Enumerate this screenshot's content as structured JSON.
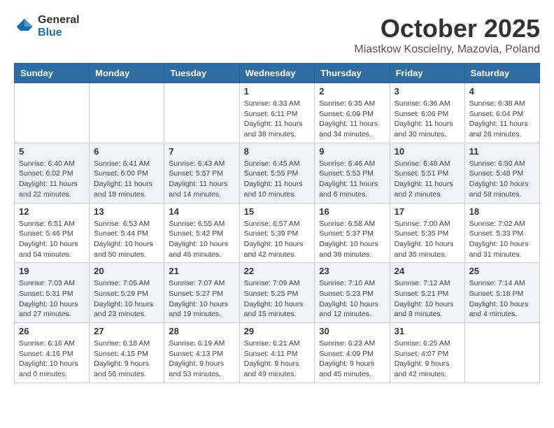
{
  "logo": {
    "general": "General",
    "blue": "Blue"
  },
  "title": "October 2025",
  "location": "Miastkow Koscielny, Mazovia, Poland",
  "days_of_week": [
    "Sunday",
    "Monday",
    "Tuesday",
    "Wednesday",
    "Thursday",
    "Friday",
    "Saturday"
  ],
  "weeks": [
    [
      {
        "day": "",
        "info": ""
      },
      {
        "day": "",
        "info": ""
      },
      {
        "day": "",
        "info": ""
      },
      {
        "day": "1",
        "info": "Sunrise: 6:33 AM\nSunset: 6:11 PM\nDaylight: 11 hours\nand 38 minutes."
      },
      {
        "day": "2",
        "info": "Sunrise: 6:35 AM\nSunset: 6:09 PM\nDaylight: 11 hours\nand 34 minutes."
      },
      {
        "day": "3",
        "info": "Sunrise: 6:36 AM\nSunset: 6:06 PM\nDaylight: 11 hours\nand 30 minutes."
      },
      {
        "day": "4",
        "info": "Sunrise: 6:38 AM\nSunset: 6:04 PM\nDaylight: 11 hours\nand 26 minutes."
      }
    ],
    [
      {
        "day": "5",
        "info": "Sunrise: 6:40 AM\nSunset: 6:02 PM\nDaylight: 11 hours\nand 22 minutes."
      },
      {
        "day": "6",
        "info": "Sunrise: 6:41 AM\nSunset: 6:00 PM\nDaylight: 11 hours\nand 18 minutes."
      },
      {
        "day": "7",
        "info": "Sunrise: 6:43 AM\nSunset: 5:57 PM\nDaylight: 11 hours\nand 14 minutes."
      },
      {
        "day": "8",
        "info": "Sunrise: 6:45 AM\nSunset: 5:55 PM\nDaylight: 11 hours\nand 10 minutes."
      },
      {
        "day": "9",
        "info": "Sunrise: 6:46 AM\nSunset: 5:53 PM\nDaylight: 11 hours\nand 6 minutes."
      },
      {
        "day": "10",
        "info": "Sunrise: 6:48 AM\nSunset: 5:51 PM\nDaylight: 11 hours\nand 2 minutes."
      },
      {
        "day": "11",
        "info": "Sunrise: 6:50 AM\nSunset: 5:48 PM\nDaylight: 10 hours\nand 58 minutes."
      }
    ],
    [
      {
        "day": "12",
        "info": "Sunrise: 6:51 AM\nSunset: 5:46 PM\nDaylight: 10 hours\nand 54 minutes."
      },
      {
        "day": "13",
        "info": "Sunrise: 6:53 AM\nSunset: 5:44 PM\nDaylight: 10 hours\nand 50 minutes."
      },
      {
        "day": "14",
        "info": "Sunrise: 6:55 AM\nSunset: 5:42 PM\nDaylight: 10 hours\nand 46 minutes."
      },
      {
        "day": "15",
        "info": "Sunrise: 6:57 AM\nSunset: 5:39 PM\nDaylight: 10 hours\nand 42 minutes."
      },
      {
        "day": "16",
        "info": "Sunrise: 6:58 AM\nSunset: 5:37 PM\nDaylight: 10 hours\nand 39 minutes."
      },
      {
        "day": "17",
        "info": "Sunrise: 7:00 AM\nSunset: 5:35 PM\nDaylight: 10 hours\nand 35 minutes."
      },
      {
        "day": "18",
        "info": "Sunrise: 7:02 AM\nSunset: 5:33 PM\nDaylight: 10 hours\nand 31 minutes."
      }
    ],
    [
      {
        "day": "19",
        "info": "Sunrise: 7:03 AM\nSunset: 5:31 PM\nDaylight: 10 hours\nand 27 minutes."
      },
      {
        "day": "20",
        "info": "Sunrise: 7:05 AM\nSunset: 5:29 PM\nDaylight: 10 hours\nand 23 minutes."
      },
      {
        "day": "21",
        "info": "Sunrise: 7:07 AM\nSunset: 5:27 PM\nDaylight: 10 hours\nand 19 minutes."
      },
      {
        "day": "22",
        "info": "Sunrise: 7:09 AM\nSunset: 5:25 PM\nDaylight: 10 hours\nand 15 minutes."
      },
      {
        "day": "23",
        "info": "Sunrise: 7:10 AM\nSunset: 5:23 PM\nDaylight: 10 hours\nand 12 minutes."
      },
      {
        "day": "24",
        "info": "Sunrise: 7:12 AM\nSunset: 5:21 PM\nDaylight: 10 hours\nand 8 minutes."
      },
      {
        "day": "25",
        "info": "Sunrise: 7:14 AM\nSunset: 5:18 PM\nDaylight: 10 hours\nand 4 minutes."
      }
    ],
    [
      {
        "day": "26",
        "info": "Sunrise: 6:16 AM\nSunset: 4:16 PM\nDaylight: 10 hours\nand 0 minutes."
      },
      {
        "day": "27",
        "info": "Sunrise: 6:18 AM\nSunset: 4:15 PM\nDaylight: 9 hours\nand 56 minutes."
      },
      {
        "day": "28",
        "info": "Sunrise: 6:19 AM\nSunset: 4:13 PM\nDaylight: 9 hours\nand 53 minutes."
      },
      {
        "day": "29",
        "info": "Sunrise: 6:21 AM\nSunset: 4:11 PM\nDaylight: 9 hours\nand 49 minutes."
      },
      {
        "day": "30",
        "info": "Sunrise: 6:23 AM\nSunset: 4:09 PM\nDaylight: 9 hours\nand 45 minutes."
      },
      {
        "day": "31",
        "info": "Sunrise: 6:25 AM\nSunset: 4:07 PM\nDaylight: 9 hours\nand 42 minutes."
      },
      {
        "day": "",
        "info": ""
      }
    ]
  ]
}
